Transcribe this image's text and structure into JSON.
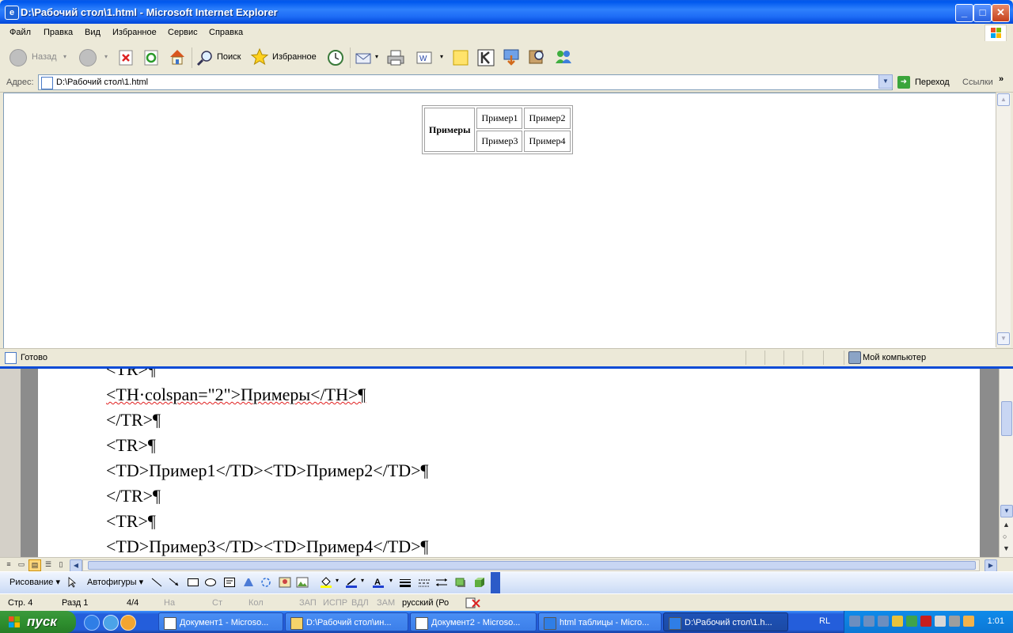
{
  "ie": {
    "title": "D:\\Рабочий стол\\1.html - Microsoft Internet Explorer",
    "menu": [
      "Файл",
      "Правка",
      "Вид",
      "Избранное",
      "Сервис",
      "Справка"
    ],
    "toolbar": {
      "back": "Назад",
      "search": "Поиск",
      "favorites": "Избранное"
    },
    "address": {
      "label": "Адрес:",
      "value": "D:\\Рабочий стол\\1.html",
      "go": "Переход",
      "links": "Ссылки"
    },
    "table": {
      "header": "Примеры",
      "rows": [
        [
          "Пример1",
          "Пример2"
        ],
        [
          "Пример3",
          "Пример4"
        ]
      ]
    },
    "status": {
      "text": "Готово",
      "zone": "Мой компьютер"
    }
  },
  "word": {
    "lines": [
      "<TR>¶",
      "<TH·colspan=\"2\">Примеры</TH>¶",
      "</TR>¶",
      "<TR>¶",
      "<TD>Пример1</TD><TD>Пример2</TD>¶",
      "</TR>¶",
      "<TR>¶",
      "<TD>Пример3</TD><TD>Пример4</TD>¶"
    ],
    "drawing": {
      "draw_label": "Рисование ▾",
      "autoshapes_label": "Автофигуры ▾"
    },
    "status": {
      "page": "Стр. 4",
      "section": "Разд 1",
      "pages": "4/4",
      "at": "На",
      "line": "Ст",
      "col": "Кол",
      "rec": "ЗАП",
      "trk": "ИСПР",
      "ext": "ВДЛ",
      "ovr": "ЗАМ",
      "lang": "русский (Ро"
    }
  },
  "taskbar": {
    "start": "пуск",
    "tasks": [
      "Документ1 - Microso...",
      "D:\\Рабочий стол\\ин...",
      "Документ2 - Microso...",
      "html таблицы - Micro...",
      "D:\\Рабочий стол\\1.h..."
    ],
    "lang": "RL",
    "clock": "1:01"
  },
  "colors": {
    "title_blue": "#0058EE",
    "taskbar_blue": "#245EDB",
    "start_green": "#2F8F2F"
  }
}
